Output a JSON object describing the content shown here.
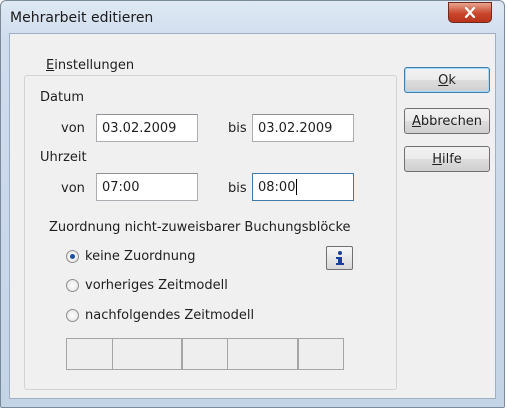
{
  "window": {
    "title": "Mehrarbeit editieren",
    "close_symbol": "x"
  },
  "group": {
    "title_underline": "E",
    "title_rest": "instellungen"
  },
  "datum": {
    "label": "Datum",
    "von_label": "von",
    "von_value": "03.02.2009",
    "bis_label": "bis",
    "bis_value": "03.02.2009"
  },
  "uhrzeit": {
    "label": "Uhrzeit",
    "von_label": "von",
    "von_value": "07:00",
    "bis_label": "bis",
    "bis_value": "08:00"
  },
  "assignment": {
    "heading": "Zuordnung nicht-zuweisbarer Buchungsblöcke",
    "options": [
      {
        "label": "keine Zuordnung",
        "checked": true
      },
      {
        "label": "vorheriges Zeitmodell",
        "checked": false
      },
      {
        "label": "nachfolgendes Zeitmodell",
        "checked": false
      }
    ],
    "info_icon": "info-icon"
  },
  "buttons": {
    "ok_underline": "O",
    "ok_rest": "k",
    "abbrechen_underline": "A",
    "abbrechen_rest": "bbrechen",
    "hilfe_underline": "H",
    "hilfe_rest": "ilfe"
  },
  "colors": {
    "close_button": "#c9472d",
    "info_icon": "#1b3e9a",
    "focus_border": "#3d7bad"
  }
}
